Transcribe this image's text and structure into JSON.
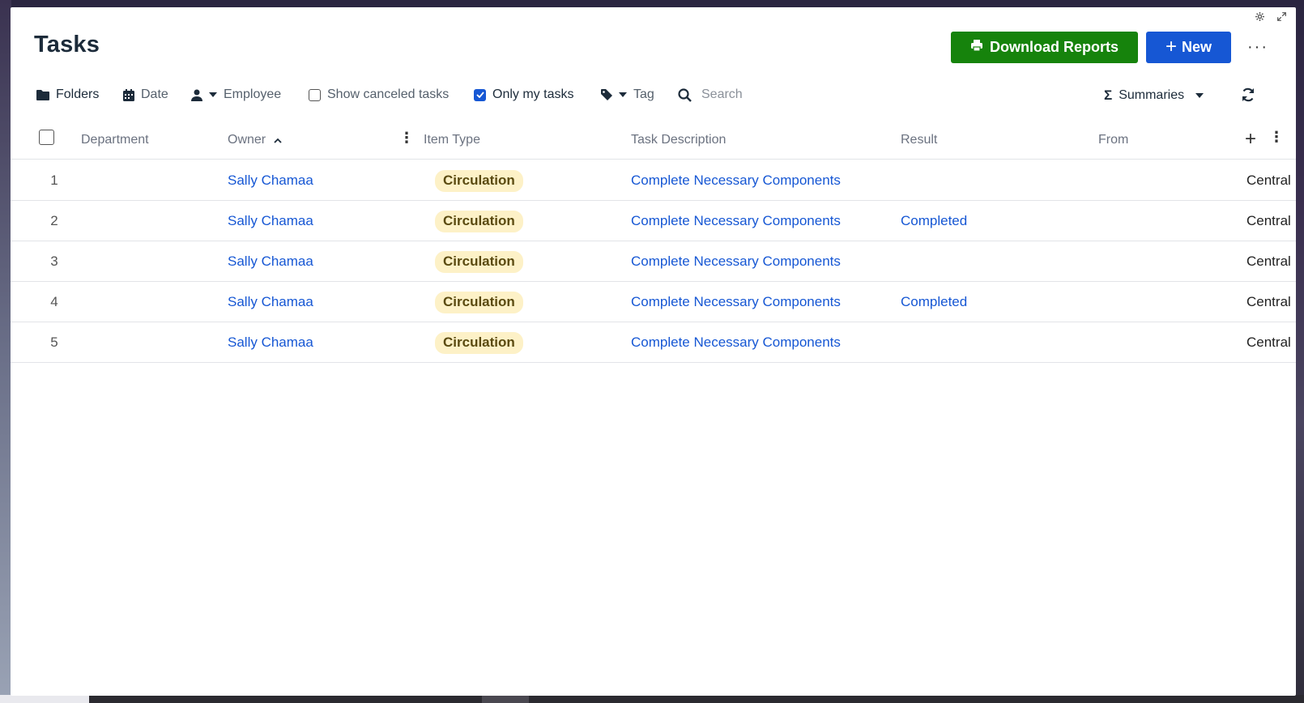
{
  "page": {
    "title": "Tasks"
  },
  "header": {
    "download_label": "Download Reports",
    "new_label": "New",
    "more_label": "···"
  },
  "toolbar": {
    "folders": "Folders",
    "date": "Date",
    "employee": "Employee",
    "show_canceled": "Show canceled tasks",
    "only_my_tasks": "Only my tasks",
    "tag": "Tag",
    "search_placeholder": "Search",
    "summaries": "Summaries"
  },
  "columns": {
    "department": "Department",
    "owner": "Owner",
    "item_type": "Item Type",
    "task_description": "Task Description",
    "result": "Result",
    "from": "From"
  },
  "rows": [
    {
      "num": "1",
      "owner": "Sally Chamaa",
      "item_type": "Circulation",
      "description": "Complete Necessary Components",
      "result": "",
      "from": "Central"
    },
    {
      "num": "2",
      "owner": "Sally Chamaa",
      "item_type": "Circulation",
      "description": "Complete Necessary Components",
      "result": "Completed",
      "from": "Central"
    },
    {
      "num": "3",
      "owner": "Sally Chamaa",
      "item_type": "Circulation",
      "description": "Complete Necessary Components",
      "result": "",
      "from": "Central"
    },
    {
      "num": "4",
      "owner": "Sally Chamaa",
      "item_type": "Circulation",
      "description": "Complete Necessary Components",
      "result": "Completed",
      "from": "Central"
    },
    {
      "num": "5",
      "owner": "Sally Chamaa",
      "item_type": "Circulation",
      "description": "Complete Necessary Components",
      "result": "",
      "from": "Central"
    }
  ],
  "colors": {
    "download_button": "#16830c",
    "new_button": "#1657d4",
    "link": "#1657d4",
    "badge_bg": "#fdf1c7"
  },
  "icons": {
    "download": "printer-icon",
    "new": "plus-icon",
    "folders": "folder-icon",
    "date": "calendar-icon",
    "employee": "person-icon",
    "tag": "tag-icon",
    "search": "search-icon",
    "summaries": "sigma-icon",
    "refresh": "refresh-icon"
  }
}
